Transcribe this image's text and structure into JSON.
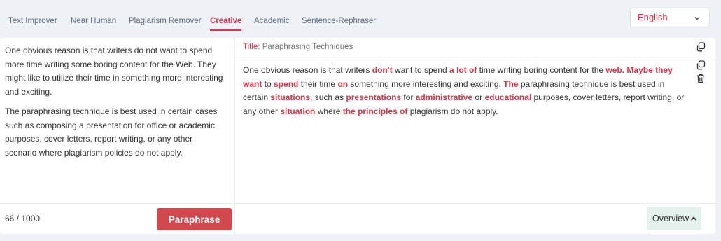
{
  "tabs": [
    {
      "label": "Text Improver"
    },
    {
      "label": "Near Human"
    },
    {
      "label": "Plagiarism Remover"
    },
    {
      "label": "Creative",
      "active": true
    },
    {
      "label": "Academic"
    },
    {
      "label": "Sentence-Rephraser"
    }
  ],
  "language": {
    "selected": "English"
  },
  "input": {
    "paragraphs": [
      "One obvious reason is that writers do not want to spend more time writing some boring content for the Web. They might like to utilize their time in something more interesting and exciting.",
      "The paraphrasing technique is best used in certain cases such as composing a presentation for office or academic purposes, cover letters, report writing, or any other scenario where plagiarism policies do not apply."
    ],
    "counter": "66 / 1000",
    "paraphrase_label": "Paraphrase"
  },
  "output": {
    "title_key": "Title:",
    "title_value": "Paraphrasing Techniques",
    "segments": [
      {
        "t": "One obvious reason is that writers ",
        "hl": false
      },
      {
        "t": "don't",
        "hl": true
      },
      {
        "t": " want to spend ",
        "hl": false
      },
      {
        "t": "a lot of",
        "hl": true
      },
      {
        "t": " time writing boring content for the ",
        "hl": false
      },
      {
        "t": "web. Maybe they want",
        "hl": true
      },
      {
        "t": " to ",
        "hl": false
      },
      {
        "t": "spend",
        "hl": true
      },
      {
        "t": " their time ",
        "hl": false
      },
      {
        "t": "on",
        "hl": true
      },
      {
        "t": " something more interesting and exciting. ",
        "hl": false
      },
      {
        "t": "The",
        "hl": true
      },
      {
        "t": " paraphrasing technique is best used in certain ",
        "hl": false
      },
      {
        "t": "situations",
        "hl": true
      },
      {
        "t": ", such as ",
        "hl": false
      },
      {
        "t": "presentations",
        "hl": true
      },
      {
        "t": " for ",
        "hl": false
      },
      {
        "t": "administrative",
        "hl": true
      },
      {
        "t": " or ",
        "hl": false
      },
      {
        "t": "educational",
        "hl": true
      },
      {
        "t": " purposes, cover letters, report writing, or any other ",
        "hl": false
      },
      {
        "t": "situation",
        "hl": true
      },
      {
        "t": " where ",
        "hl": false
      },
      {
        "t": "the principles of",
        "hl": true
      },
      {
        "t": " plagiarism do not apply.",
        "hl": false
      }
    ],
    "overview_label": "Overview"
  },
  "icons": {
    "title_copy": "copy-icon",
    "text_copy": "copy-icon",
    "delete": "trash-icon",
    "overview_toggle": "chevron-up-icon",
    "language_toggle": "chevron-down-icon"
  },
  "colors": {
    "accent": "#d0384b",
    "button": "#d0494f",
    "overview_bg": "#e5f1ec",
    "page_bg": "#eef1f6"
  }
}
